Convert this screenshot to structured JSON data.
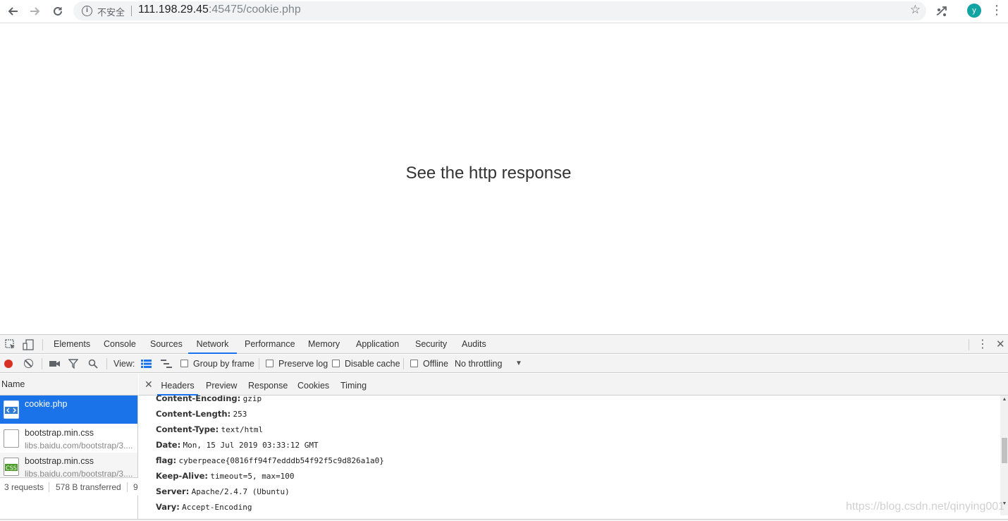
{
  "browser": {
    "security_label": "不安全",
    "url_host": "111.198.29.45",
    "url_rest": ":45475/cookie.php",
    "avatar_letter": "y",
    "icons": [
      "back-icon",
      "forward-icon",
      "reload-icon",
      "info-icon",
      "star-icon",
      "extension-icon",
      "menu-icon"
    ]
  },
  "page": {
    "heading": "See the http response"
  },
  "devtools": {
    "tabs": [
      "Elements",
      "Console",
      "Sources",
      "Network",
      "Performance",
      "Memory",
      "Application",
      "Security",
      "Audits"
    ],
    "active_tab": "Network",
    "filterbar": {
      "view_label": "View:",
      "group_by_frame": "Group by frame",
      "preserve_log": "Preserve log",
      "disable_cache": "Disable cache",
      "offline": "Offline",
      "throttling": "No throttling"
    },
    "request_list": {
      "header": "Name",
      "rows": [
        {
          "name": "cookie.php",
          "domain": "",
          "selected": true
        },
        {
          "name": "bootstrap.min.css",
          "domain": "libs.baidu.com/bootstrap/3....",
          "selected": false
        },
        {
          "name": "bootstrap.min.css",
          "domain": "libs.baidu.com/bootstrap/3....",
          "selected": false
        }
      ],
      "status": {
        "requests": "3 requests",
        "transferred": "578 B transferred",
        "extra": "9"
      }
    },
    "detail_tabs": [
      "Headers",
      "Preview",
      "Response",
      "Cookies",
      "Timing"
    ],
    "active_detail_tab": "Headers",
    "headers": [
      {
        "name": "Content-Encoding:",
        "value": "gzip"
      },
      {
        "name": "Content-Length:",
        "value": "253"
      },
      {
        "name": "Content-Type:",
        "value": "text/html"
      },
      {
        "name": "Date:",
        "value": "Mon, 15 Jul 2019 03:33:12 GMT"
      },
      {
        "name": "flag:",
        "value": "cyberpeace{0816ff94f7edddb54f92f5c9d826a1a0}"
      },
      {
        "name": "Keep-Alive:",
        "value": "timeout=5, max=100"
      },
      {
        "name": "Server:",
        "value": "Apache/2.4.7 (Ubuntu)"
      },
      {
        "name": "Vary:",
        "value": "Accept-Encoding"
      }
    ],
    "watermark": "https://blog.csdn.net/qinying001"
  }
}
